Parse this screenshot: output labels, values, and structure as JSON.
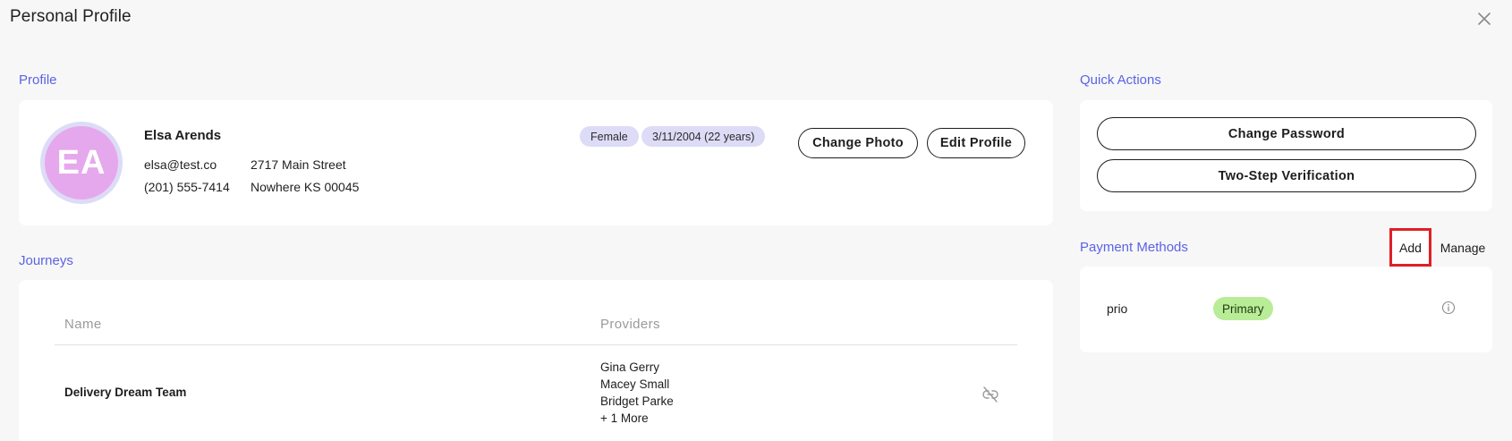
{
  "header": {
    "title": "Personal Profile",
    "close_icon": "close-icon"
  },
  "profile": {
    "section_label": "Profile",
    "avatar_initials": "EA",
    "name": "Elsa Arends",
    "email": "elsa@test.co",
    "phone": "(201) 555-7414",
    "address_line1": "2717 Main Street",
    "address_line2": "Nowhere KS 00045",
    "gender_chip": "Female",
    "dob_chip": "3/11/2004 (22 years)",
    "change_photo_label": "Change Photo",
    "edit_profile_label": "Edit Profile"
  },
  "journeys": {
    "section_label": "Journeys",
    "columns": [
      "Name",
      "Providers"
    ],
    "rows": [
      {
        "name": "Delivery Dream Team",
        "providers": [
          "Gina Gerry",
          "Macey Small",
          "Bridget Parke",
          "+ 1 More"
        ],
        "action_icon": "unlink-icon"
      }
    ]
  },
  "quick_actions": {
    "section_label": "Quick Actions",
    "change_password_label": "Change Password",
    "two_step_label": "Two-Step Verification"
  },
  "payment_methods": {
    "section_label": "Payment Methods",
    "add_label": "Add",
    "manage_label": "Manage",
    "items": [
      {
        "name": "prio",
        "badge": "Primary",
        "icon": "info-icon"
      }
    ]
  },
  "colors": {
    "accent": "#5b63e6",
    "avatar_bg": "#e6a8ec",
    "chip_bg": "#dcdcf7",
    "primary_badge_bg": "#b9ec97",
    "highlight": "#e01f27"
  }
}
